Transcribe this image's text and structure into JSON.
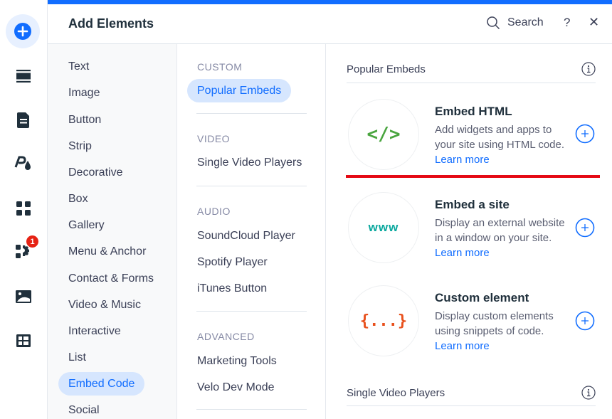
{
  "rail": {
    "items": [
      {
        "icon": "add-icon",
        "active": true
      },
      {
        "icon": "sections-icon"
      },
      {
        "icon": "pages-icon"
      },
      {
        "icon": "site-design-icon"
      },
      {
        "icon": "apps-icon"
      },
      {
        "icon": "business-apps-icon",
        "badge": "1"
      },
      {
        "icon": "media-icon"
      },
      {
        "icon": "cms-table-icon"
      }
    ]
  },
  "header": {
    "title": "Add Elements",
    "search_label": "Search",
    "help_label": "?",
    "close_label": "✕"
  },
  "categories": [
    {
      "label": "Text"
    },
    {
      "label": "Image"
    },
    {
      "label": "Button"
    },
    {
      "label": "Strip"
    },
    {
      "label": "Decorative"
    },
    {
      "label": "Box"
    },
    {
      "label": "Gallery"
    },
    {
      "label": "Menu & Anchor"
    },
    {
      "label": "Contact & Forms"
    },
    {
      "label": "Video & Music"
    },
    {
      "label": "Interactive"
    },
    {
      "label": "List"
    },
    {
      "label": "Embed Code",
      "active": true
    },
    {
      "label": "Social"
    }
  ],
  "subcategories": {
    "custom": {
      "title": "CUSTOM",
      "items": [
        "Popular Embeds"
      ]
    },
    "video": {
      "title": "VIDEO",
      "items": [
        "Single Video Players"
      ]
    },
    "audio": {
      "title": "AUDIO",
      "items": [
        "SoundCloud Player",
        "Spotify Player",
        "iTunes Button"
      ]
    },
    "advanced": {
      "title": "ADVANCED",
      "items": [
        "Marketing Tools",
        "Velo Dev Mode"
      ]
    }
  },
  "content": {
    "section_title": "Popular Embeds",
    "next_section_title": "Single Video Players",
    "cards": [
      {
        "title": "Embed HTML",
        "description": "Add widgets and apps to your site using HTML code.",
        "link": "Learn more",
        "icon_text": "</>",
        "icon_color": "#4aa53f"
      },
      {
        "title": "Embed a site",
        "description": "Display an external website in a window on your site.",
        "link": "Learn more",
        "icon_text": "www",
        "icon_color": "#0aa89e"
      },
      {
        "title": "Custom element",
        "description": "Display custom elements using snippets of code.",
        "link": "Learn more",
        "icon_text": "{...}",
        "icon_color": "#e8501c"
      }
    ]
  },
  "colors": {
    "accent": "#116dff",
    "highlight_bg": "#d6e6fe",
    "badge": "#e62214",
    "annotation_line": "#e50914"
  }
}
